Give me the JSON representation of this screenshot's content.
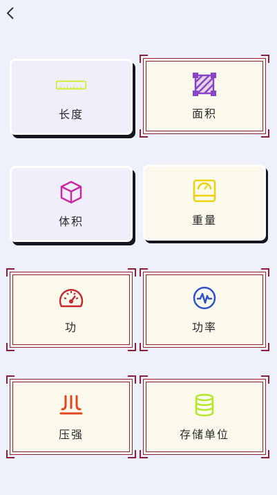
{
  "header": {
    "back_icon": "chevron-left-icon"
  },
  "cards": [
    {
      "label": "长度",
      "icon": "ruler-icon",
      "color": "#c9ef1d"
    },
    {
      "label": "面积",
      "icon": "area-icon",
      "color": "#8a44c9"
    },
    {
      "label": "体积",
      "icon": "cube-icon",
      "color": "#c629a0"
    },
    {
      "label": "重量",
      "icon": "scale-icon",
      "color": "#e9d30e"
    },
    {
      "label": "功",
      "icon": "speedometer-icon",
      "color": "#c62630"
    },
    {
      "label": "功率",
      "icon": "pulse-icon",
      "color": "#2b52c8"
    },
    {
      "label": "压强",
      "icon": "pressure-icon",
      "color": "#e0461e"
    },
    {
      "label": "存储单位",
      "icon": "database-icon",
      "color": "#b4e62a"
    }
  ]
}
